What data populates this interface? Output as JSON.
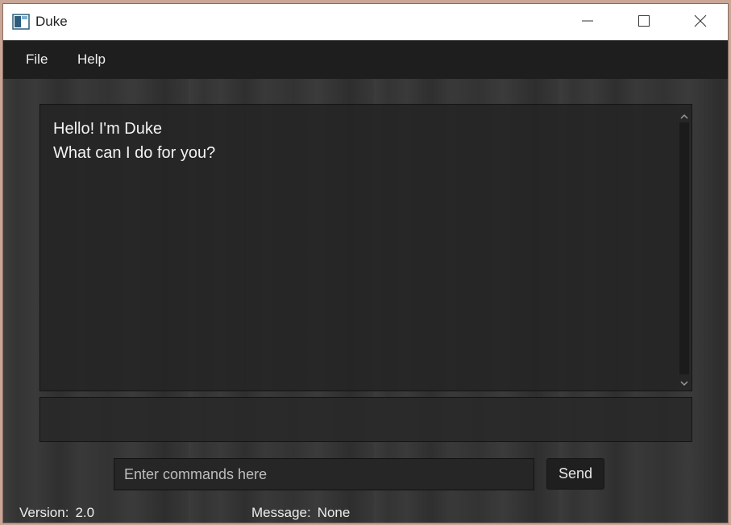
{
  "window": {
    "title": "Duke",
    "icon": "app-window-icon",
    "controls": [
      "minimize-icon",
      "maximize-icon",
      "close-icon"
    ]
  },
  "menu": {
    "items": [
      {
        "label": "File"
      },
      {
        "label": "Help"
      }
    ]
  },
  "chat": {
    "lines": [
      "Hello! I'm Duke",
      "What can I do for you?"
    ]
  },
  "output": {
    "text": ""
  },
  "command": {
    "placeholder": "Enter commands here",
    "value": ""
  },
  "send_label": "Send",
  "status": {
    "version_label": "Version:",
    "version_value": "2.0",
    "message_label": "Message:",
    "message_value": "None"
  },
  "colors": {
    "titlebar": "#ffffff",
    "menubar": "#1e1e1e",
    "panel": "#242424",
    "text": "#f2f2f2"
  }
}
